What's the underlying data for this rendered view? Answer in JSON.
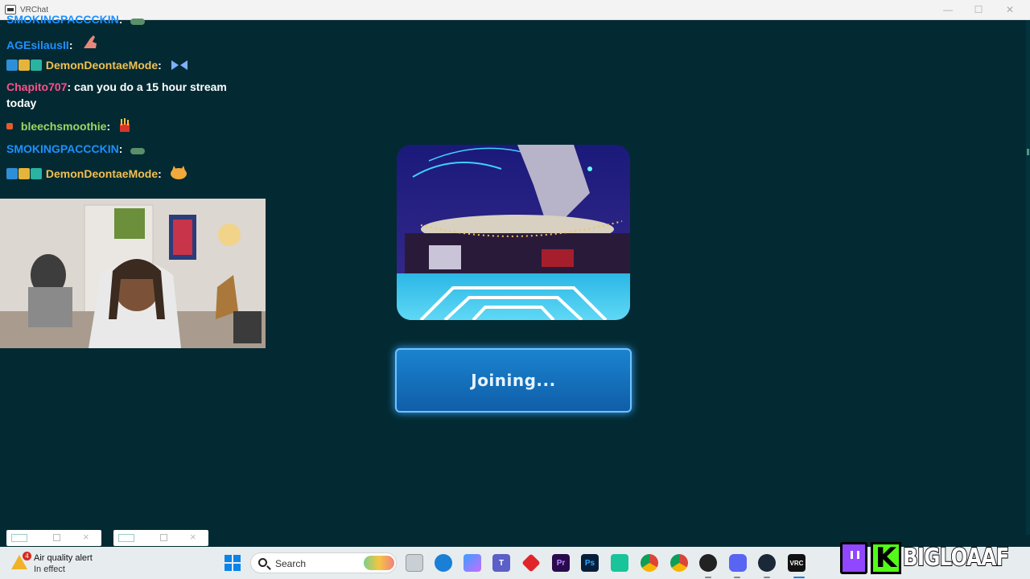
{
  "window": {
    "title": "VRChat",
    "ghost_text": "... ..."
  },
  "chat": {
    "messages": [
      {
        "user": "SMOKINGPACCCKIN",
        "text": "",
        "emote": "frog-emote"
      },
      {
        "user": "AGEsilausII",
        "text": "",
        "emote": "hand-emote"
      },
      {
        "user": "DemonDeontaeMode",
        "text": "",
        "emote": "butterfly-emote"
      },
      {
        "user": "Chapito707",
        "text": "can you do a 15 hour stream",
        "text2": "today"
      },
      {
        "user": "bleechsmoothie",
        "text": "",
        "emote": "fries-emote"
      },
      {
        "user": "SMOKINGPACCCKIN",
        "text": "",
        "emote": "frog-emote"
      },
      {
        "user": "DemonDeontaeMode",
        "text": "",
        "emote": "cat-emote"
      }
    ],
    "separator": ":"
  },
  "loader": {
    "join_label": "Joining..."
  },
  "taskbar": {
    "alert_title": "Air quality alert",
    "alert_subtitle": "In effect",
    "alert_count": "4",
    "search_placeholder": "Search",
    "apps": [
      "file-explorer",
      "edge",
      "copilot",
      "teams",
      "app-red",
      "premiere-pro",
      "photoshop",
      "app-green",
      "chrome-a",
      "chrome",
      "obs",
      "discord",
      "steam",
      "vrchat"
    ]
  },
  "overlay": {
    "streamer_name": "BIGLOAAF",
    "kick_letter": "K"
  },
  "colors": {
    "background": "#032a33",
    "join_button": "#1b83cf",
    "user_blue": "#1e90ff",
    "user_gold": "#f1c050",
    "user_pink": "#ff4f8b",
    "user_green": "#9ad863"
  }
}
